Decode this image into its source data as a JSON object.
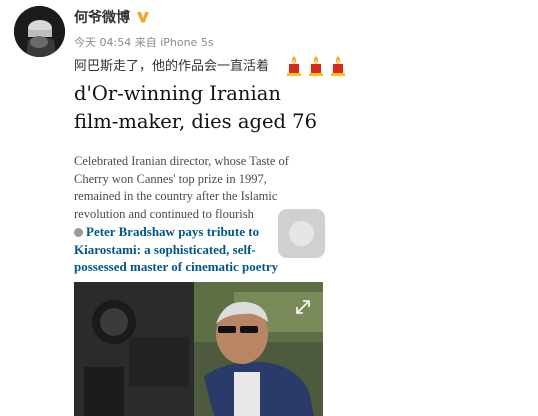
{
  "post": {
    "author": "何爷微博",
    "time": "今天 04:54",
    "source": "来自 iPhone 5s",
    "text": "阿巴斯走了，他的作品会一直活着"
  },
  "article": {
    "headline_line1": "d'Or-winning Iranian",
    "headline_line2": "film-maker, dies aged 76",
    "standfirst_line1": "Celebrated Iranian director, whose Taste of",
    "standfirst_line2": "Cherry won Cannes' top prize in 1997,",
    "standfirst_line3": "remained in the country after the Islamic",
    "standfirst_line4": "revolution and continued to flourish",
    "related_line1": "Peter Bradshaw pays tribute to",
    "related_line2": "Kiarostami: a sophisticated, self-",
    "related_line3": "possessed master of cinematic poetry"
  },
  "icons": {
    "verified": "verified-v-badge-icon",
    "candle": "candle-icon",
    "expand": "expand-icon"
  },
  "colors": {
    "verified_badge": "#f6a623",
    "link": "#005689",
    "meta": "#8c8c8c"
  }
}
